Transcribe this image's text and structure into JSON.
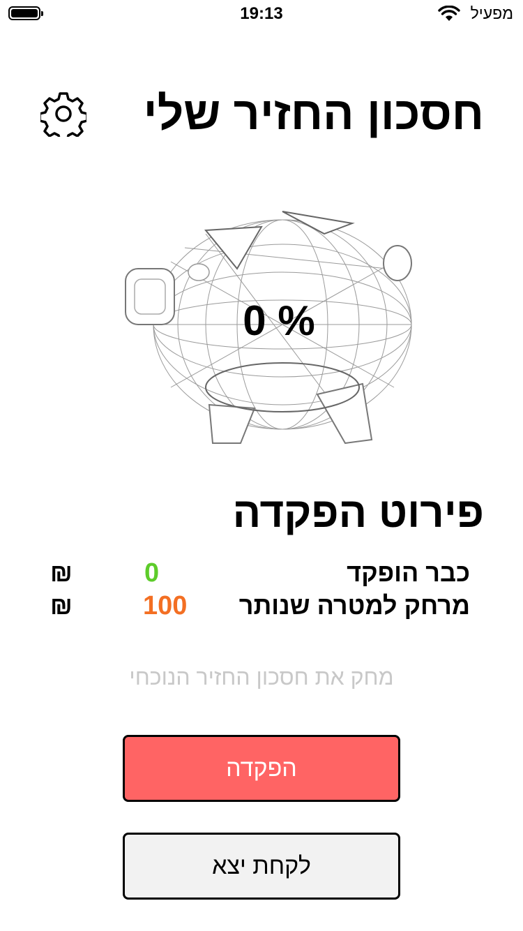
{
  "status_bar": {
    "time": "19:13",
    "carrier": "מפעיל"
  },
  "header": {
    "title": "חסכון החזיר שלי",
    "settings_icon": "gear-icon"
  },
  "piggy": {
    "percent": "0 %"
  },
  "details": {
    "title": "פירוט הפקדה",
    "rows": [
      {
        "label": "כבר הופקד",
        "value": "0",
        "currency": "₪",
        "color": "#5dcc2a"
      },
      {
        "label": "מרחק למטרה שנותר",
        "value": "100",
        "currency": "₪",
        "color": "#f36f23"
      }
    ]
  },
  "delete_link": "מחק את חסכון החזיר הנוכחי",
  "buttons": {
    "deposit": "הפקדה",
    "withdraw": "לקחת יצא"
  },
  "colors": {
    "deposit_bg": "#ff6464",
    "withdraw_bg": "#f2f2f2"
  }
}
